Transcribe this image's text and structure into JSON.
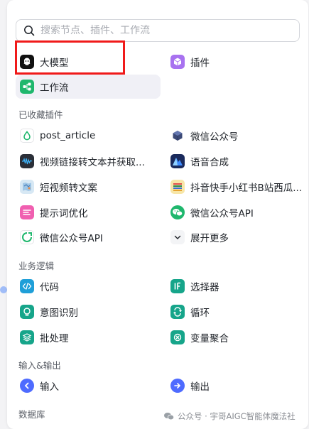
{
  "search": {
    "placeholder": "搜索节点、插件、工作流"
  },
  "top_items": [
    {
      "label": "大模型",
      "icon": "model-icon"
    },
    {
      "label": "插件",
      "icon": "plugin-cube-icon"
    },
    {
      "label": "工作流",
      "icon": "workflow-icon",
      "selected": true
    }
  ],
  "sections": {
    "favorites": {
      "title": "已收藏插件",
      "items": [
        {
          "label": "post_article",
          "icon": "green-drop-icon"
        },
        {
          "label": "微信公众号",
          "icon": "cube-icon"
        },
        {
          "label": "视频链接转文本并获取...",
          "icon": "video-wave-icon"
        },
        {
          "label": "语音合成",
          "icon": "mountain-icon"
        },
        {
          "label": "短视频转文案",
          "icon": "map-icon"
        },
        {
          "label": "抖音快手小红书B站西瓜...",
          "icon": "colorful-bars-icon"
        },
        {
          "label": "提示词优化",
          "icon": "prompt-icon"
        },
        {
          "label": "微信公众号API",
          "icon": "wechat-icon"
        },
        {
          "label": "微信公众号API",
          "icon": "green-loop-icon"
        },
        {
          "label": "展开更多",
          "icon": "chevron-down-icon"
        }
      ]
    },
    "logic": {
      "title": "业务逻辑",
      "items": [
        {
          "label": "代码",
          "icon": "code-icon"
        },
        {
          "label": "选择器",
          "icon": "if-icon"
        },
        {
          "label": "意图识别",
          "icon": "intent-icon"
        },
        {
          "label": "循环",
          "icon": "loop-icon"
        },
        {
          "label": "批处理",
          "icon": "layers-icon"
        },
        {
          "label": "变量聚合",
          "icon": "merge-icon"
        }
      ]
    },
    "io": {
      "title": "输入&输出",
      "items": [
        {
          "label": "输入",
          "icon": "input-icon"
        },
        {
          "label": "输出",
          "icon": "output-icon"
        }
      ]
    },
    "database": {
      "title": "数据库"
    }
  },
  "colors": {
    "highlight": "#f01a1a",
    "green": "#1fb76d",
    "purple": "#7c5cff",
    "blue": "#4e6bff",
    "teal": "#16a58a"
  },
  "watermark": {
    "text": "公众号 · 宇哥AIGC智能体魔法社"
  }
}
